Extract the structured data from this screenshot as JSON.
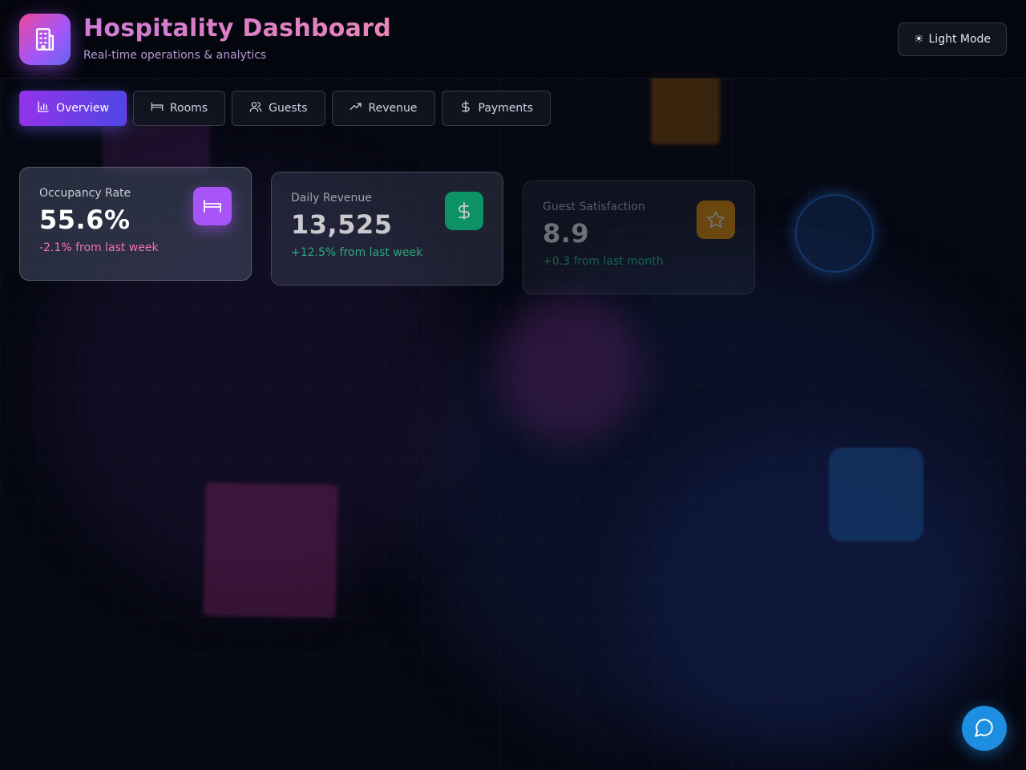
{
  "header": {
    "title": "Hospitality Dashboard",
    "subtitle": "Real-time operations & analytics",
    "logo_icon": "building-icon",
    "theme_toggle": {
      "icon": "sun-icon",
      "label": "Light Mode"
    }
  },
  "tabs": [
    {
      "label": "Overview",
      "icon": "bar-chart-icon",
      "active": true
    },
    {
      "label": "Rooms",
      "icon": "bed-icon",
      "active": false
    },
    {
      "label": "Guests",
      "icon": "users-icon",
      "active": false
    },
    {
      "label": "Revenue",
      "icon": "trending-up-icon",
      "active": false
    },
    {
      "label": "Payments",
      "icon": "dollar-icon",
      "active": false
    }
  ],
  "stats": [
    {
      "label": "Occupancy Rate",
      "value": "55.6%",
      "change": "-2.1% from last week",
      "icon": "bed-icon",
      "accent": "#a855f7",
      "change_color": "#f472b6"
    },
    {
      "label": "Daily Revenue",
      "value": "13,525",
      "change": "+12.5% from last week",
      "icon": "dollar-icon",
      "accent": "#10b981",
      "change_color": "#34d399"
    },
    {
      "label": "Guest Satisfaction",
      "value": "8.9",
      "change": "+0.3 from last month",
      "icon": "star-icon",
      "accent": "#f59e0b",
      "change_color": "#34d399"
    }
  ],
  "chat": {
    "icon": "chat-bubble-icon"
  },
  "colors": {
    "background": "#060812",
    "accent_gradient_start": "#9333ea",
    "accent_gradient_end": "#4f46e5",
    "chat_button": "#1d8ee0"
  }
}
